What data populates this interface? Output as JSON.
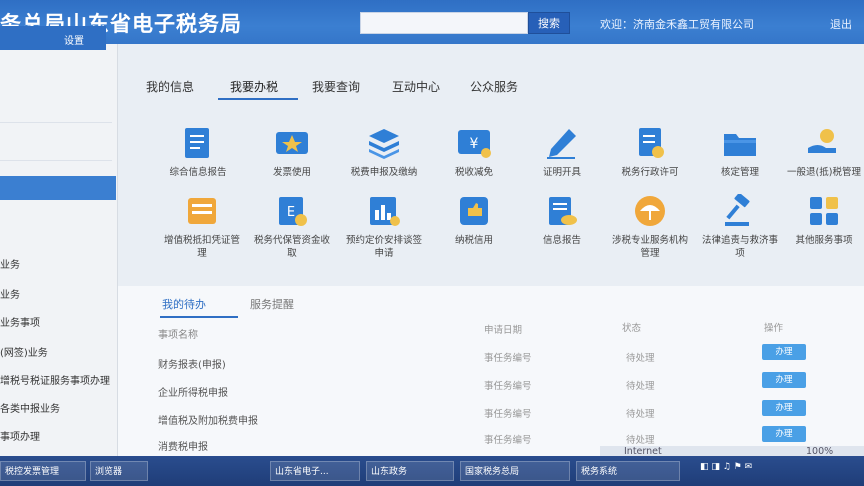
{
  "header": {
    "title": "务总局山东省电子税务局",
    "search_button": "搜索",
    "welcome": "欢迎：济南金禾鑫工贸有限公司",
    "logout": "退出"
  },
  "sidebar": {
    "settings": "设置",
    "items": [
      "业务",
      "业务",
      "业务事项",
      "(网签)业务",
      "增税号税证服务事项办理",
      "各类中报业务",
      "事项办理"
    ]
  },
  "nav": {
    "tabs": [
      "我的信息",
      "我要办税",
      "我要查询",
      "互动中心",
      "公众服务"
    ]
  },
  "tiles": [
    {
      "label": "综合信息报告",
      "icon": "document-icon",
      "color": "#2f7fd6"
    },
    {
      "label": "发票使用",
      "icon": "ticket-icon",
      "color": "#2f7fd6"
    },
    {
      "label": "税费申报及缴纳",
      "icon": "layers-icon",
      "color": "#2f7fd6"
    },
    {
      "label": "税收减免",
      "icon": "yuan-card-icon",
      "color": "#2f7fd6"
    },
    {
      "label": "证明开具",
      "icon": "pen-icon",
      "color": "#2f7fd6"
    },
    {
      "label": "税务行政许可",
      "icon": "license-icon",
      "color": "#2f7fd6"
    },
    {
      "label": "核定管理",
      "icon": "folder-icon",
      "color": "#2f7fd6"
    },
    {
      "label": "一般退(抵)税管理",
      "icon": "hand-coin-icon",
      "color": "#2f7fd6"
    },
    {
      "label": "增值税抵扣凭证管理",
      "icon": "card-stack-icon",
      "color": "#f0a73a"
    },
    {
      "label": "税务代保管资金收取",
      "icon": "receipt-icon",
      "color": "#2f7fd6"
    },
    {
      "label": "预约定价安排谈签申请",
      "icon": "chart-icon",
      "color": "#2f7fd6"
    },
    {
      "label": "纳税信用",
      "icon": "badge-icon",
      "color": "#2f7fd6"
    },
    {
      "label": "信息报告",
      "icon": "eye-doc-icon",
      "color": "#2f7fd6"
    },
    {
      "label": "涉税专业服务机构管理",
      "icon": "umbrella-icon",
      "color": "#f0a73a"
    },
    {
      "label": "法律追责与救济事项",
      "icon": "gavel-icon",
      "color": "#2f7fd6"
    },
    {
      "label": "其他服务事项",
      "icon": "grid-icon",
      "color": "#2f7fd6"
    }
  ],
  "subtabs": [
    "我的待办",
    "服务提醒"
  ],
  "rows": [
    {
      "left": "事项名称",
      "ref": "申请日期",
      "col2": "状态",
      "action": "操作"
    },
    {
      "left": "财务报表(申报)",
      "ref": "事任务编号",
      "col2": "待处理",
      "action": "办理"
    },
    {
      "left": "企业所得税申报",
      "ref": "事任务编号",
      "col2": "待处理",
      "action": "办理"
    },
    {
      "left": "增值税及附加税费申报",
      "ref": "事任务编号",
      "col2": "待处理",
      "action": "办理"
    },
    {
      "left": "消费税申报",
      "ref": "事任务编号",
      "col2": "待处理",
      "action": "办理"
    }
  ],
  "taskbar": {
    "items": [
      "税控发票管理",
      "浏览器",
      "山东省电子...",
      "山东政务",
      "国家税务总局",
      "税务系统"
    ],
    "zoom": "100%",
    "status": "Internet"
  }
}
